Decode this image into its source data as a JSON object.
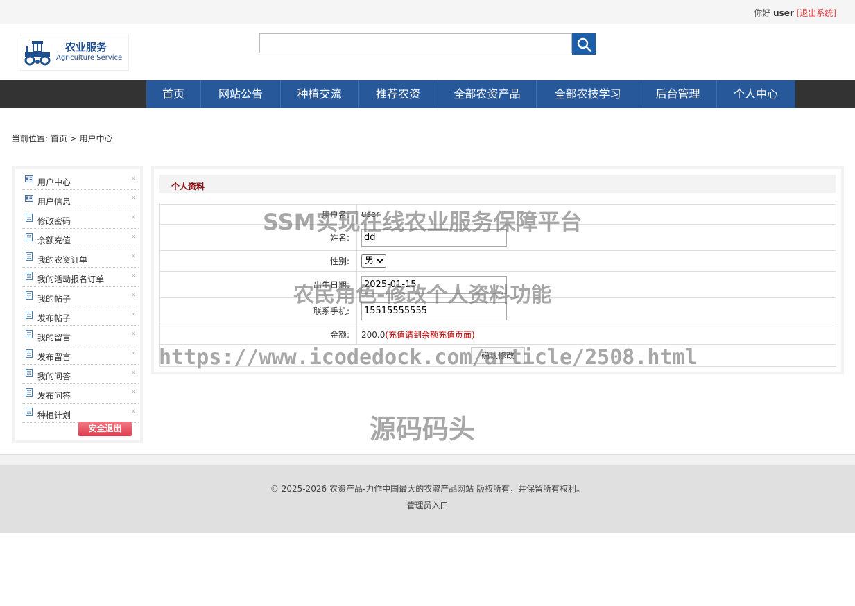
{
  "topbar": {
    "greeting": "你好",
    "username": "user",
    "logout_link": "[退出系统]"
  },
  "logo": {
    "cn": "农业服务",
    "en": "Agriculture Service",
    "icon": "tractor-icon"
  },
  "search": {
    "value": "",
    "icon": "search-icon"
  },
  "nav": {
    "items": [
      "首页",
      "网站公告",
      "种植交流",
      "推荐农资",
      "全部农资产品",
      "全部农技学习",
      "后台管理",
      "个人中心"
    ]
  },
  "breadcrumb": {
    "prefix": "当前位置:",
    "home": "首页",
    "sep": ">",
    "current": "用户中心"
  },
  "sidebar": {
    "items": [
      "用户中心",
      "用户信息",
      "修改密码",
      "余额充值",
      "我的农资订单",
      "我的活动报名订单",
      "我的帖子",
      "发布帖子",
      "我的留言",
      "发布留言",
      "我的问答",
      "发布问答",
      "种植计划"
    ],
    "logout": "安全退出"
  },
  "profile": {
    "title": "个人资料",
    "username_label": "用户名:",
    "username": "user",
    "name_label": "姓名:",
    "name": "dd",
    "gender_label": "性别:",
    "gender": "男",
    "birthday_label": "出生日期:",
    "birthday": "2025-01-15",
    "phone_label": "联系手机:",
    "phone": "15515555555",
    "balance_label": "金额:",
    "balance": "200.0",
    "recharge_hint": "(充值请到余额充值页面)",
    "submit": "确认修改"
  },
  "footer": {
    "copyright": "© 2025-2026 农资产品-力作中国最大的农资产品网站 版权所有，并保留所有权利。",
    "admin": "管理员入口"
  },
  "watermarks": {
    "w1": "SSM实现在线农业服务保障平台",
    "w2": "农民角色-修改个人资料功能",
    "w3": "https://www.icodedock.com/article/2508.html",
    "w4": "源码码头"
  },
  "colors": {
    "nav_bg": "#27599a",
    "nav_bar": "#333333",
    "accent_red": "#cc0000",
    "search_btn": "#1c5ea8"
  }
}
